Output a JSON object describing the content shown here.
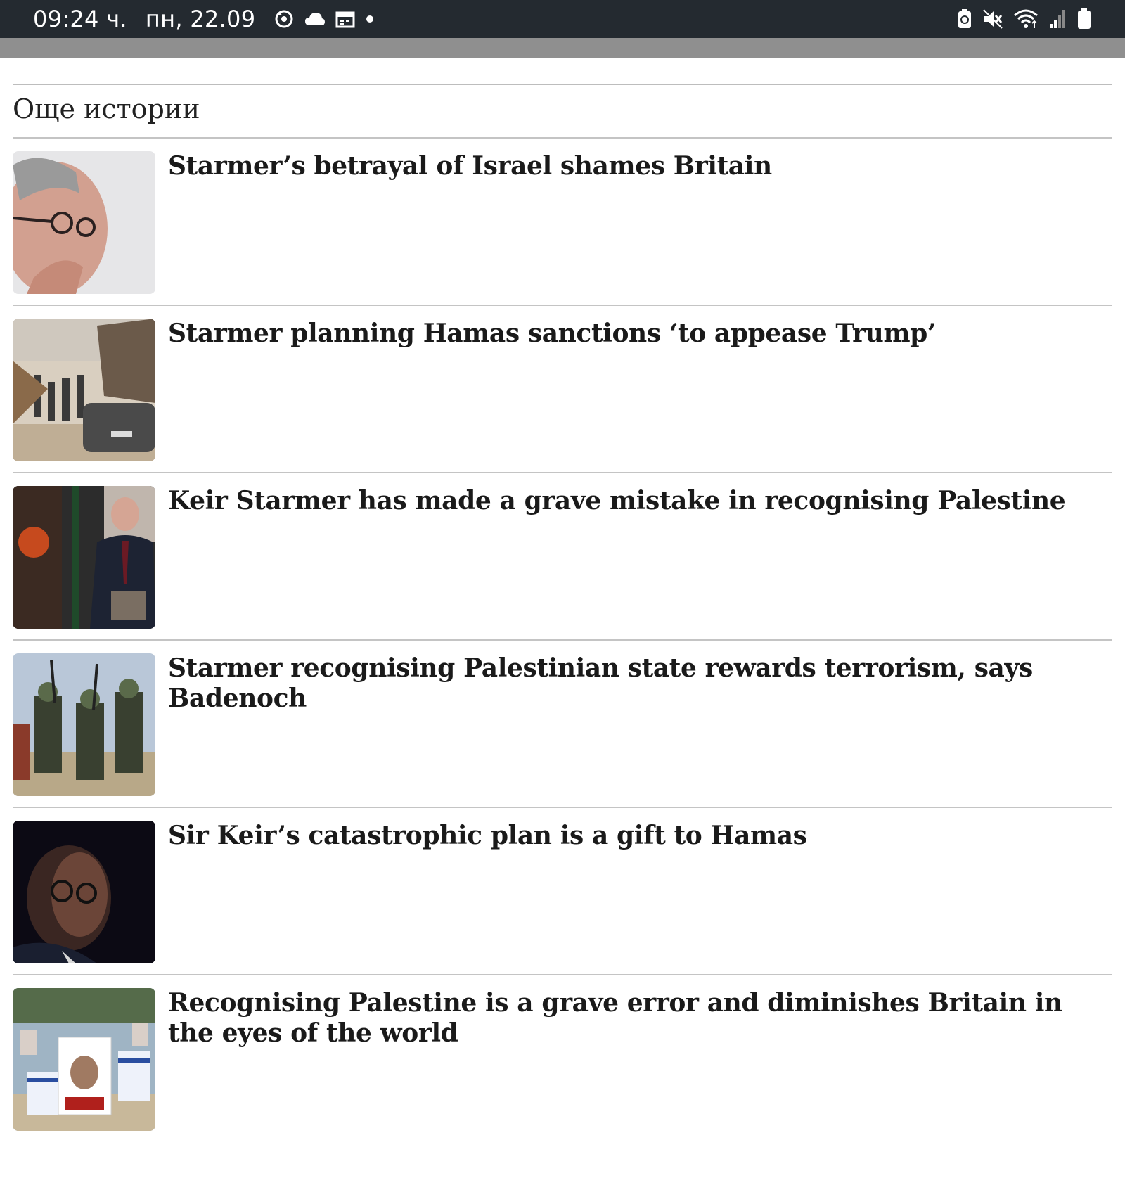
{
  "status_bar": {
    "time": "09:24 ч.",
    "date": "пн, 22.09",
    "left_icons": [
      "sync-icon",
      "cloud-icon",
      "calendar-icon",
      "dot-icon"
    ],
    "right_icons": [
      "battery-saver-icon",
      "mute-icon",
      "wifi-icon",
      "signal-icon",
      "battery-icon"
    ]
  },
  "section": {
    "title": "Още истории"
  },
  "stories": [
    {
      "headline": "Starmer’s betrayal of Israel shames Britain",
      "thumb": "starmer-glasses-photo"
    },
    {
      "headline": "Starmer planning Hamas sanctions ‘to appease Trump’",
      "thumb": "gaza-displaced-crowd-photo"
    },
    {
      "headline": "Keir Starmer has made a grave mistake in recognising Palestine",
      "thumb": "starmer-podium-photo"
    },
    {
      "headline": "Starmer recognising Palestinian state rewards terrorism, says Badenoch",
      "thumb": "armed-militants-photo"
    },
    {
      "headline": "Sir Keir’s catastrophic plan is a gift to Hamas",
      "thumb": "starmer-dark-portrait-photo"
    },
    {
      "headline": "Recognising Palestine is a grave error and diminishes Britain in the eyes of the world",
      "thumb": "hostage-memorial-photo"
    }
  ],
  "colors": {
    "status_bar_bg": "#242a30",
    "gray_strip": "#8f8f8f",
    "divider": "#c4c4c4",
    "headline_text": "#1a1a1a"
  }
}
